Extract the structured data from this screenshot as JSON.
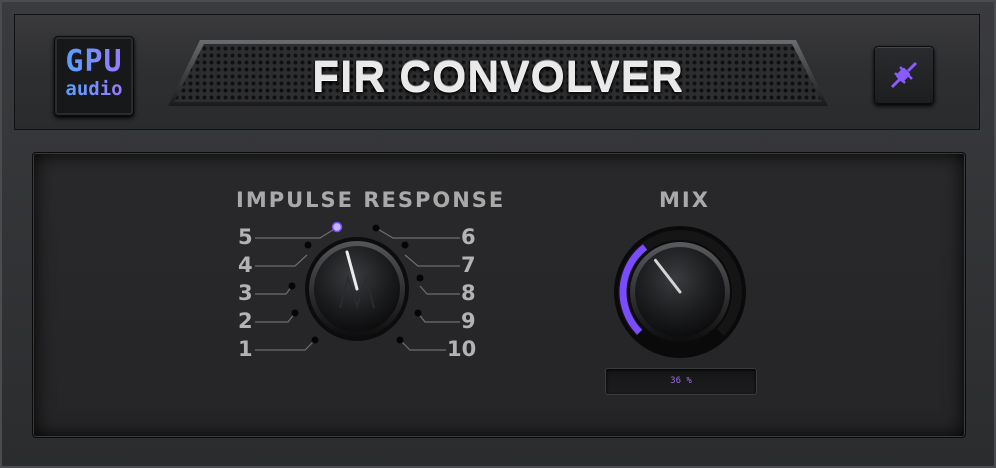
{
  "app": {
    "title": "FIR CONVOLVER",
    "logo_line1": "GPU",
    "logo_line2": "audio"
  },
  "impulse_response": {
    "label": "IMPULSE RESPONSE",
    "positions": [
      "1",
      "2",
      "3",
      "4",
      "5",
      "6",
      "7",
      "8",
      "9",
      "10"
    ],
    "selected": "5"
  },
  "mix": {
    "label": "MIX",
    "value_text": "36 %",
    "value_fraction": 0.36
  },
  "colors": {
    "accent": "#7a4cff",
    "accent_light": "#b59dff",
    "knob_ring": "#0e0e0f"
  },
  "icons": {
    "bypass": "plug-icon"
  }
}
